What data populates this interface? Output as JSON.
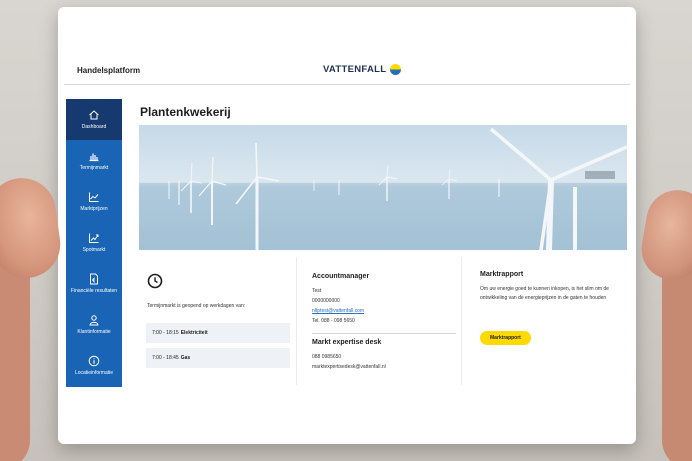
{
  "header": {
    "platform_name": "Handelsplatform",
    "brand": "VATTENFALL"
  },
  "sidebar": {
    "items": [
      {
        "label": "Dashboard",
        "icon": "home-icon",
        "active": true
      },
      {
        "label": "Termijnmarkt",
        "icon": "bar-chart-icon",
        "active": false
      },
      {
        "label": "Marktprijzen",
        "icon": "line-chart-icon",
        "active": false
      },
      {
        "label": "Spotmarkt",
        "icon": "trend-chart-icon",
        "active": false
      },
      {
        "label": "Financiële resultaten",
        "icon": "document-euro-icon",
        "active": false
      },
      {
        "label": "Klantinformatie",
        "icon": "person-icon",
        "active": false
      },
      {
        "label": "Locatieinformatie",
        "icon": "info-icon",
        "active": false
      }
    ]
  },
  "main": {
    "title": "Plantenkwekerij"
  },
  "hours": {
    "icon": "clock-icon",
    "intro": "Termijnmarkt is geopend op werkdagen van:",
    "rows": [
      {
        "time": "7:00 - 18:15",
        "label": "Elektriciteit"
      },
      {
        "time": "7:00 - 18:45",
        "label": "Gas"
      }
    ]
  },
  "account": {
    "heading": "Accountmanager",
    "name": "Test",
    "number": "0000000000",
    "email": "nltptest@vattenfall.com",
    "phone": "Tel. 088 - 098 5650",
    "desk_heading": "Markt expertise desk",
    "desk_phone": "088 0985650",
    "desk_email": "marktexpertisedesk@vattenfall.nl"
  },
  "report": {
    "heading": "Marktrapport",
    "text": "Om uw energie goed te kunnen inkopen, is het slim om de ontwikkeling van de energieprijzen in de gaten te houden",
    "button": "Marktrapport"
  },
  "colors": {
    "sidebar": "#1964b4",
    "sidebar_active": "#163a70",
    "accent_yellow": "#ffda00",
    "brand_blue": "#1e324f"
  }
}
